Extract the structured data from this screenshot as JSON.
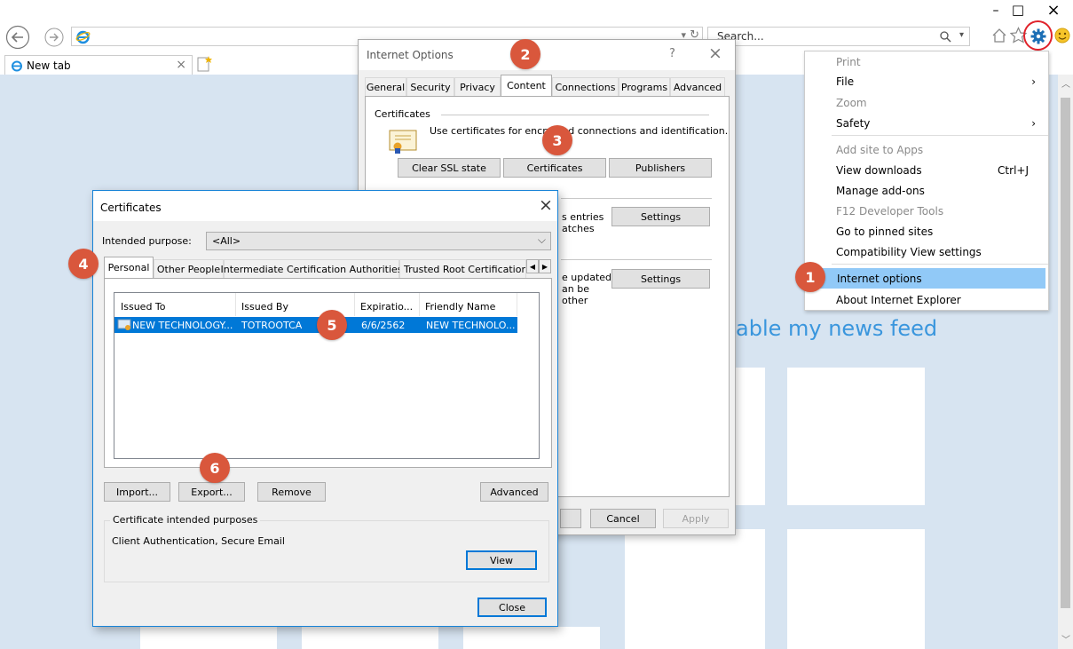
{
  "browser": {
    "tab_label": "New tab",
    "tab_close": "×",
    "search_placeholder": "Search...",
    "search_value": "Search...",
    "addr_dropdown": "▾",
    "refresh": "↻",
    "window_min": "–",
    "window_max": "□",
    "window_close": "×",
    "news_feed_text": "able my news feed"
  },
  "gear_menu": {
    "items": [
      {
        "label": "Print",
        "disabled": true
      },
      {
        "label": "File",
        "arrow": "›"
      },
      {
        "label": "Zoom",
        "disabled": true
      },
      {
        "label": "Safety",
        "arrow": "›"
      },
      {
        "label": "Add site to Apps",
        "disabled": true
      },
      {
        "label": "View downloads",
        "shortcut": "Ctrl+J"
      },
      {
        "label": "Manage add-ons"
      },
      {
        "label": "F12 Developer Tools",
        "disabled": true
      },
      {
        "label": "Go to pinned sites"
      },
      {
        "label": "Compatibility View settings"
      },
      {
        "label": "Internet options",
        "highlighted": true
      },
      {
        "label": "About Internet Explorer"
      }
    ]
  },
  "internet_options": {
    "title": "Internet Options",
    "help": "?",
    "close": "×",
    "tabs": [
      "General",
      "Security",
      "Privacy",
      "Content",
      "Connections",
      "Programs",
      "Advanced"
    ],
    "certificates_group": "Certificates",
    "certificates_desc": "Use certificates for encrypted connections and identification.",
    "btn_clear_ssl": "Clear SSL state",
    "btn_certificates": "Certificates",
    "btn_publishers": "Publishers",
    "autocomplete_text_1": "s entries",
    "autocomplete_text_2": "atches",
    "btn_settings_1": "Settings",
    "feeds_text_1": "e updated",
    "feeds_text_2": "an be",
    "feeds_text_3": "other",
    "btn_settings_2": "Settings",
    "btn_cancel": "Cancel",
    "btn_apply": "Apply"
  },
  "certificates_dialog": {
    "title": "Certificates",
    "close": "×",
    "intended_purpose_label": "Intended purpose:",
    "intended_purpose_value": "<All>",
    "tabs": [
      "Personal",
      "Other People",
      "Intermediate Certification Authorities",
      "Trusted Root Certification"
    ],
    "columns": [
      "Issued To",
      "Issued By",
      "Expiratio...",
      "Friendly Name"
    ],
    "rows": [
      {
        "issued_to": "NEW TECHNOLOGY...",
        "issued_by": "TOTROOTCA",
        "expiration": "6/6/2562",
        "friendly_name": "NEW TECHNOLO..."
      }
    ],
    "btn_import": "Import...",
    "btn_export": "Export...",
    "btn_remove": "Remove",
    "btn_advanced": "Advanced",
    "purposes_group": "Certificate intended purposes",
    "purposes_value": "Client Authentication, Secure Email",
    "btn_view": "View",
    "btn_close": "Close"
  },
  "badges": [
    "1",
    "2",
    "3",
    "4",
    "5",
    "6"
  ],
  "colors": {
    "badge": "#d9573c",
    "selection": "#0078d7",
    "menu_highlight": "#91c9f7",
    "newtab_bg": "#d7e4f1",
    "news_text": "#3a96dd"
  }
}
